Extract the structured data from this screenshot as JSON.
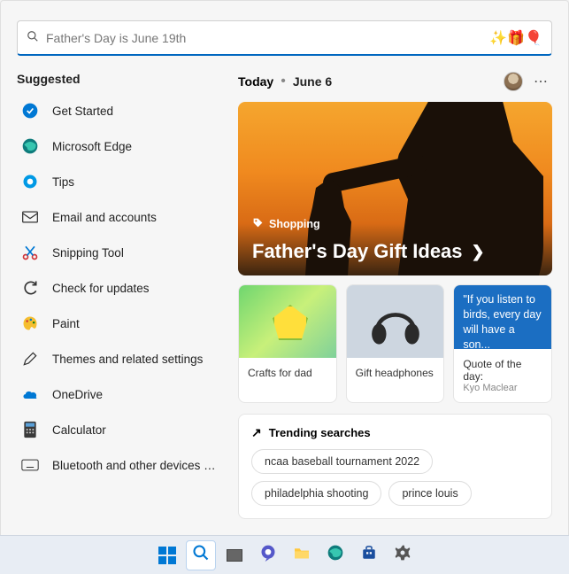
{
  "search": {
    "placeholder": "Father's Day is June 19th"
  },
  "suggested": {
    "title": "Suggested",
    "items": [
      {
        "label": "Get Started"
      },
      {
        "label": "Microsoft Edge"
      },
      {
        "label": "Tips"
      },
      {
        "label": "Email and accounts"
      },
      {
        "label": "Snipping Tool"
      },
      {
        "label": "Check for updates"
      },
      {
        "label": "Paint"
      },
      {
        "label": "Themes and related settings"
      },
      {
        "label": "OneDrive"
      },
      {
        "label": "Calculator"
      },
      {
        "label": "Bluetooth and other devices sett..."
      }
    ]
  },
  "today": {
    "label": "Today",
    "separator": "•",
    "date": "June 6"
  },
  "hero": {
    "category_label": "Shopping",
    "title": "Father's Day Gift Ideas"
  },
  "cards": [
    {
      "title": "Crafts for dad"
    },
    {
      "title": "Gift headphones"
    },
    {
      "quote_text": "\"If you listen to birds, every day will have a son...",
      "title": "Quote of the day:",
      "subtitle": "Kyo Maclear"
    }
  ],
  "trending": {
    "title": "Trending searches",
    "chips": [
      "ncaa baseball tournament 2022",
      "philadelphia shooting",
      "prince louis"
    ]
  },
  "taskbar": {
    "items": [
      {
        "name": "start"
      },
      {
        "name": "search"
      },
      {
        "name": "task-view"
      },
      {
        "name": "chat"
      },
      {
        "name": "file-explorer"
      },
      {
        "name": "edge"
      },
      {
        "name": "store"
      },
      {
        "name": "settings"
      }
    ]
  }
}
